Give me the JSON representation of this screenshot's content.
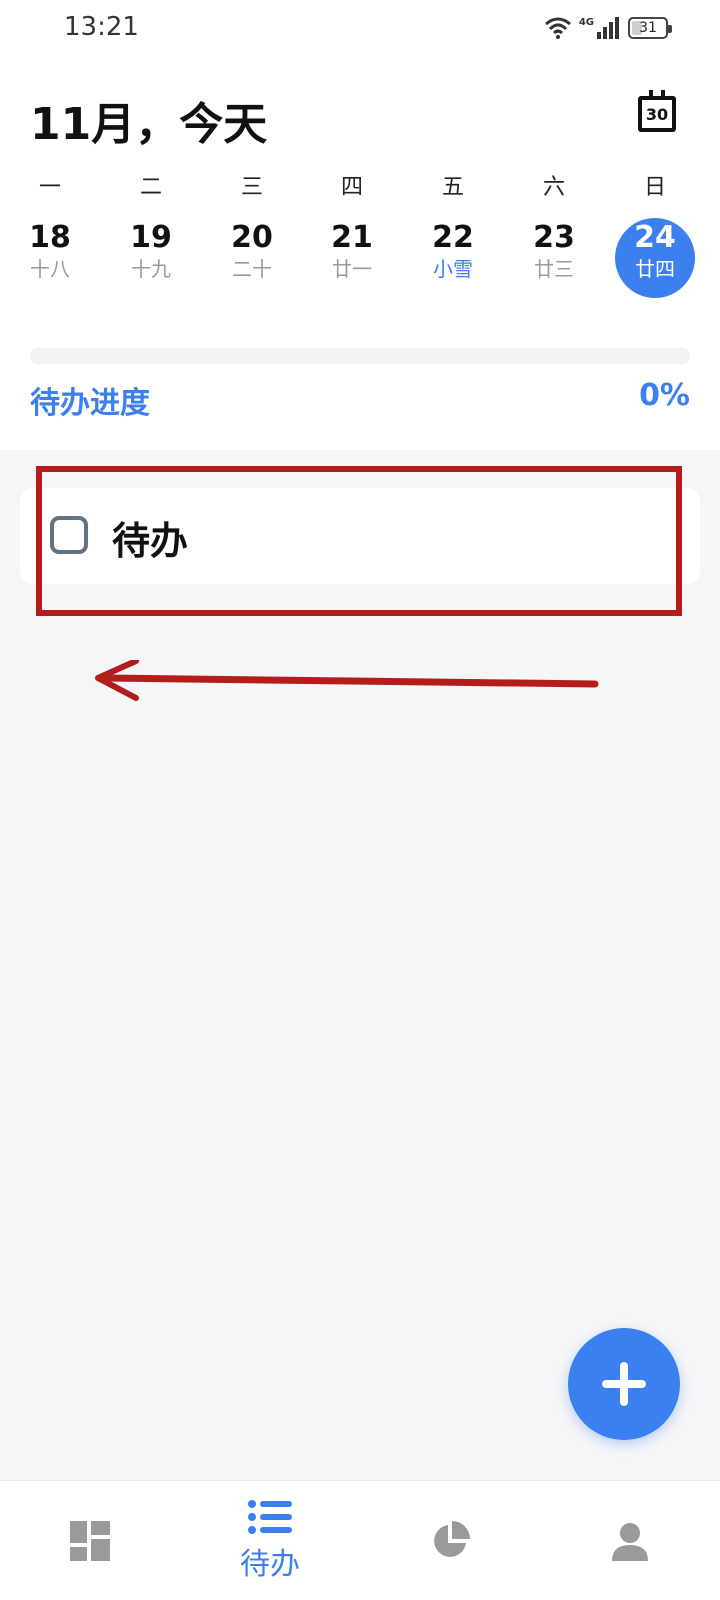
{
  "status_bar": {
    "time": "13:21",
    "network": "4G",
    "battery": "31",
    "battery_level": 0.31
  },
  "header": {
    "title": "11月，今天",
    "calendar_icon_text": "30"
  },
  "week": {
    "days": [
      {
        "weekday": "一",
        "date": "18",
        "lunar": "十八"
      },
      {
        "weekday": "二",
        "date": "19",
        "lunar": "十九"
      },
      {
        "weekday": "三",
        "date": "20",
        "lunar": "二十"
      },
      {
        "weekday": "四",
        "date": "21",
        "lunar": "廿一"
      },
      {
        "weekday": "五",
        "date": "22",
        "lunar": "小雪"
      },
      {
        "weekday": "六",
        "date": "23",
        "lunar": "廿三"
      },
      {
        "weekday": "日",
        "date": "24",
        "lunar": "廿四"
      }
    ],
    "selected_index": 6,
    "festival_index": 4
  },
  "progress": {
    "label": "待办进度",
    "percent_text": "0%",
    "value": 0
  },
  "tasks": [
    {
      "title": "待办",
      "checked": false
    }
  ],
  "bottom_nav": {
    "active_label": "待办"
  },
  "colors": {
    "accent": "#3b80ee",
    "annotation": "#b51c1c",
    "background": "#f5f6f8"
  },
  "icons": {
    "fab": "plus-icon",
    "nav": [
      "grid-dashboard-icon",
      "list-icon",
      "pie-chart-icon",
      "user-icon"
    ],
    "header": "calendar-icon",
    "status": [
      "wifi-icon",
      "signal-icon",
      "battery-icon"
    ]
  }
}
